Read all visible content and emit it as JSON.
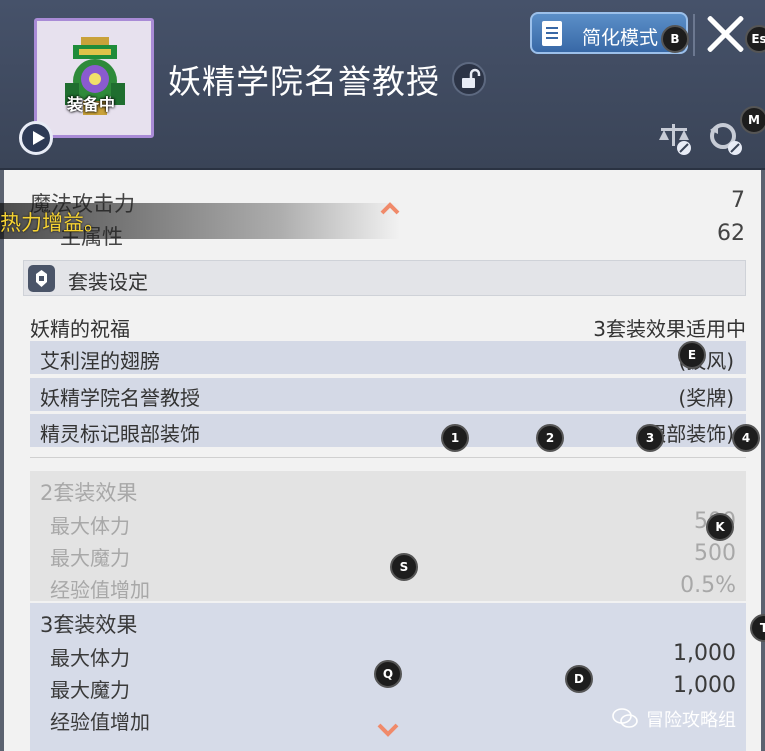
{
  "header": {
    "title": "妖精学院名誉教授",
    "equipped_label": "装备中",
    "simple_mode_label": "简化模式"
  },
  "stats": [
    {
      "label": "魔法攻击力",
      "value": "7"
    },
    {
      "label": "主属性",
      "value": "62"
    }
  ],
  "tooltip": {
    "text": "热力增益。"
  },
  "set": {
    "section_title": "套装设定",
    "name": "妖精的祝福",
    "status": "3套装效果适用中",
    "items": [
      {
        "label": "艾利涅的翅膀",
        "slot": "(披风)"
      },
      {
        "label": "妖精学院名誉教授",
        "slot": "(奖牌)"
      },
      {
        "label": "精灵标记眼部装饰",
        "slot": "(眼部装饰)"
      }
    ]
  },
  "effects": [
    {
      "title": "2套装效果",
      "active": false,
      "stats": [
        {
          "label": "最大体力",
          "value": "500"
        },
        {
          "label": "最大魔力",
          "value": "500"
        },
        {
          "label": "经验值增加",
          "value": "0.5%"
        }
      ]
    },
    {
      "title": "3套装效果",
      "active": true,
      "stats": [
        {
          "label": "最大体力",
          "value": "1,000"
        },
        {
          "label": "最大魔力",
          "value": "1,000"
        },
        {
          "label": "经验值增加",
          "value": ""
        }
      ]
    }
  ],
  "key_hints": {
    "b": "B",
    "esc": "Es",
    "m": "M",
    "e": "E",
    "one": "1",
    "two": "2",
    "three": "3",
    "four": "4",
    "k": "K",
    "s": "S",
    "t": "T",
    "q": "Q",
    "d": "D"
  },
  "watermark": {
    "text": "冒险攻略组"
  },
  "colors": {
    "accent": "#3868a6",
    "tooltip_text": "#f5d233",
    "chevron": "#f08a6a"
  }
}
